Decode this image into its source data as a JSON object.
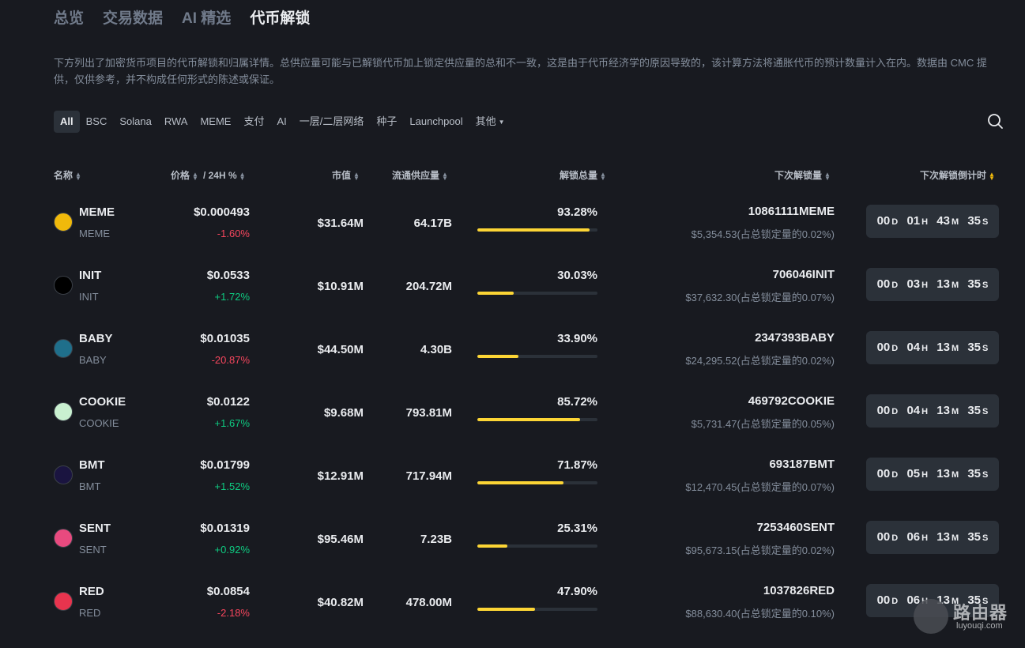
{
  "top_tabs": [
    "总览",
    "交易数据",
    "AI 精选",
    "代币解锁"
  ],
  "description": "下方列出了加密货币项目的代币解锁和归属详情。总供应量可能与已解锁代币加上锁定供应量的总和不一致，这是由于代币经济学的原因导致的，该计算方法将通胀代币的预计数量计入在内。数据由 CMC 提供，仅供参考，并不构成任何形式的陈述或保证。",
  "filters": [
    "All",
    "BSC",
    "Solana",
    "RWA",
    "MEME",
    "支付",
    "AI",
    "一层/二层网络",
    "种子",
    "Launchpool",
    "其他"
  ],
  "headers": {
    "name": "名称",
    "price": "价格",
    "change": "/ 24H %",
    "mcap": "市值",
    "circ": "流通供应量",
    "unlocked": "解锁总量",
    "next_amount": "下次解锁量",
    "countdown": "下次解锁倒计时"
  },
  "countdown_units": {
    "d": "D",
    "h": "H",
    "m": "M",
    "s": "S"
  },
  "rows": [
    {
      "name": "MEME",
      "symbol": "MEME",
      "price": "$0.000493",
      "change": "-1.60%",
      "mcap": "$31.64M",
      "circ": "64.17B",
      "unlocked_pct": "93.28%",
      "unlocked_value": 93.28,
      "next_amount": "10861111MEME",
      "next_usd": "$5,354.53(占总锁定量的0.02%)",
      "cd_d": "00",
      "cd_h": "01",
      "cd_m": "43",
      "cd_s": "35",
      "icon": "meme-icon",
      "icon_color": "#f0b90b"
    },
    {
      "name": "INIT",
      "symbol": "INIT",
      "price": "$0.0533",
      "change": "+1.72%",
      "mcap": "$10.91M",
      "circ": "204.72M",
      "unlocked_pct": "30.03%",
      "unlocked_value": 30.03,
      "next_amount": "706046INIT",
      "next_usd": "$37,632.30(占总锁定量的0.07%)",
      "cd_d": "00",
      "cd_h": "03",
      "cd_m": "13",
      "cd_s": "35",
      "icon": "init-icon",
      "icon_color": "#000000"
    },
    {
      "name": "BABY",
      "symbol": "BABY",
      "price": "$0.01035",
      "change": "-20.87%",
      "mcap": "$44.50M",
      "circ": "4.30B",
      "unlocked_pct": "33.90%",
      "unlocked_value": 33.9,
      "next_amount": "2347393BABY",
      "next_usd": "$24,295.52(占总锁定量的0.02%)",
      "cd_d": "00",
      "cd_h": "04",
      "cd_m": "13",
      "cd_s": "35",
      "icon": "baby-icon",
      "icon_color": "#1f6f8b"
    },
    {
      "name": "COOKIE",
      "symbol": "COOKIE",
      "price": "$0.0122",
      "change": "+1.67%",
      "mcap": "$9.68M",
      "circ": "793.81M",
      "unlocked_pct": "85.72%",
      "unlocked_value": 85.72,
      "next_amount": "469792COOKIE",
      "next_usd": "$5,731.47(占总锁定量的0.05%)",
      "cd_d": "00",
      "cd_h": "04",
      "cd_m": "13",
      "cd_s": "35",
      "icon": "cookie-icon",
      "icon_color": "#c9f0d0"
    },
    {
      "name": "BMT",
      "symbol": "BMT",
      "price": "$0.01799",
      "change": "+1.52%",
      "mcap": "$12.91M",
      "circ": "717.94M",
      "unlocked_pct": "71.87%",
      "unlocked_value": 71.87,
      "next_amount": "693187BMT",
      "next_usd": "$12,470.45(占总锁定量的0.07%)",
      "cd_d": "00",
      "cd_h": "05",
      "cd_m": "13",
      "cd_s": "35",
      "icon": "bmt-icon",
      "icon_color": "#1a1440"
    },
    {
      "name": "SENT",
      "symbol": "SENT",
      "price": "$0.01319",
      "change": "+0.92%",
      "mcap": "$95.46M",
      "circ": "7.23B",
      "unlocked_pct": "25.31%",
      "unlocked_value": 25.31,
      "next_amount": "7253460SENT",
      "next_usd": "$95,673.15(占总锁定量的0.02%)",
      "cd_d": "00",
      "cd_h": "06",
      "cd_m": "13",
      "cd_s": "35",
      "icon": "sent-icon",
      "icon_color": "#e84a7f"
    },
    {
      "name": "RED",
      "symbol": "RED",
      "price": "$0.0854",
      "change": "-2.18%",
      "mcap": "$40.82M",
      "circ": "478.00M",
      "unlocked_pct": "47.90%",
      "unlocked_value": 47.9,
      "next_amount": "1037826RED",
      "next_usd": "$88,630.40(占总锁定量的0.10%)",
      "cd_d": "00",
      "cd_h": "06",
      "cd_m": "13",
      "cd_s": "35",
      "icon": "red-icon",
      "icon_color": "#e8344e"
    }
  ],
  "watermark": {
    "title": "路由器",
    "sub": "luyouqi.com"
  }
}
